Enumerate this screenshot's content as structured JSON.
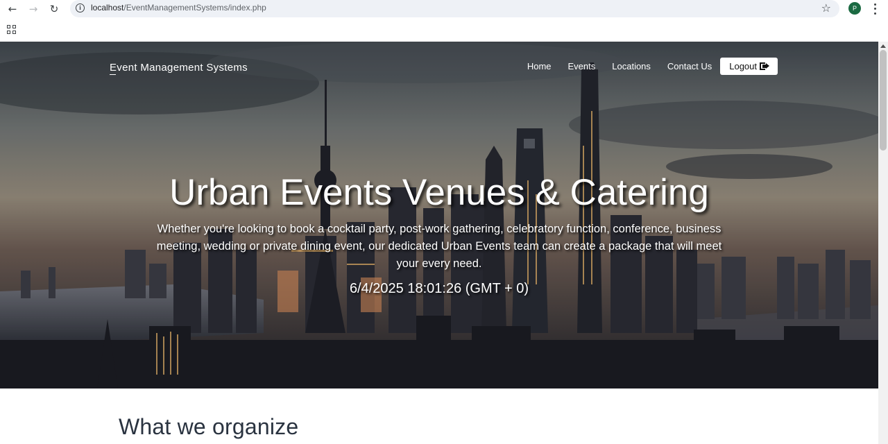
{
  "browser": {
    "url_host": "localhost",
    "url_path": "/EventManagementSystems/index.php",
    "profile_initial": "P"
  },
  "navbar": {
    "brand": "Event Management Systems",
    "links": [
      "Home",
      "Events",
      "Locations",
      "Contact Us"
    ],
    "logout_label": "Logout"
  },
  "hero": {
    "title": "Urban Events Venues & Catering",
    "subtitle": "Whether you're looking to book a cocktail party, post-work gathering, celebratory function, conference, business meeting, wedding or private dining event, our dedicated Urban Events team can create a package that will meet your every need.",
    "clock": "6/4/2025 18:01:26 (GMT + 0)"
  },
  "sections": {
    "what_we_organize": "What we organize"
  },
  "colors": {
    "profile_badge": "#1b6a42",
    "section_title": "#2a3340"
  }
}
